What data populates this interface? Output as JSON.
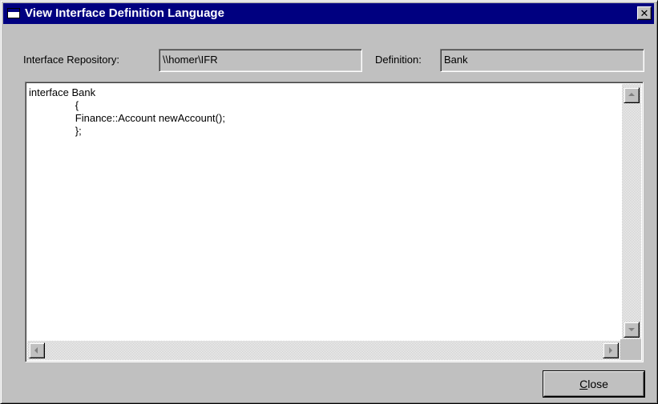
{
  "window": {
    "title": "View Interface Definition Language",
    "close_glyph": "✕"
  },
  "fields": {
    "repository_label": "Interface Repository:",
    "repository_value": "\\\\homer\\IFR",
    "definition_label": "Definition:",
    "definition_value": "Bank"
  },
  "editor": {
    "code": "interface Bank\n                {\n                Finance::Account newAccount();\n                };"
  },
  "buttons": {
    "close_mnemonic": "C",
    "close_rest": "lose"
  },
  "icons": {
    "title": "window-icon",
    "close": "close-icon",
    "scroll_up": "arrow-up-icon",
    "scroll_down": "arrow-down-icon",
    "scroll_left": "arrow-left-icon",
    "scroll_right": "arrow-right-icon"
  },
  "colors": {
    "titlebar": "#000080",
    "face": "#c0c0c0"
  }
}
